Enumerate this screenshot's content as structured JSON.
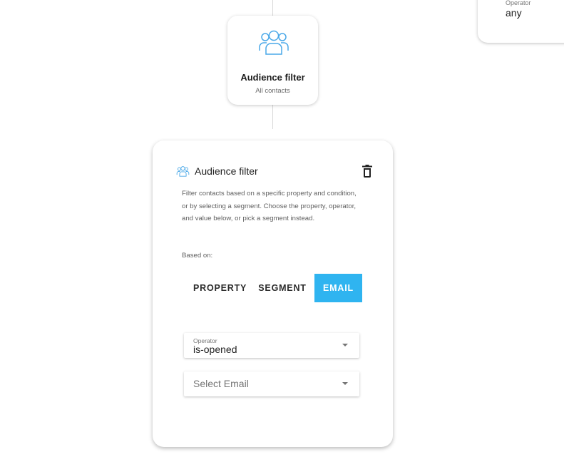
{
  "partial_card": {
    "operator_label": "Operator",
    "operator_value": "any"
  },
  "node": {
    "icon": "audience-group-icon",
    "title": "Audience filter",
    "subtitle": "All contacts"
  },
  "panel": {
    "icon": "audience-group-icon",
    "title": "Audience filter",
    "delete_icon": "trash-icon",
    "description": "Filter contacts based on a specific property and condition, or by selecting a segment. Choose the property, operator, and value below, or pick a segment instead.",
    "based_on_label": "Based on:",
    "toggle": {
      "options": [
        "PROPERTY",
        "SEGMENT",
        "EMAIL"
      ],
      "selected": "EMAIL"
    },
    "operator_select": {
      "label": "Operator",
      "value": "is-opened"
    },
    "email_select": {
      "placeholder": "Select Email"
    }
  },
  "colors": {
    "accent": "#2fb4f0",
    "icon_blue": "#4aa8e8"
  }
}
